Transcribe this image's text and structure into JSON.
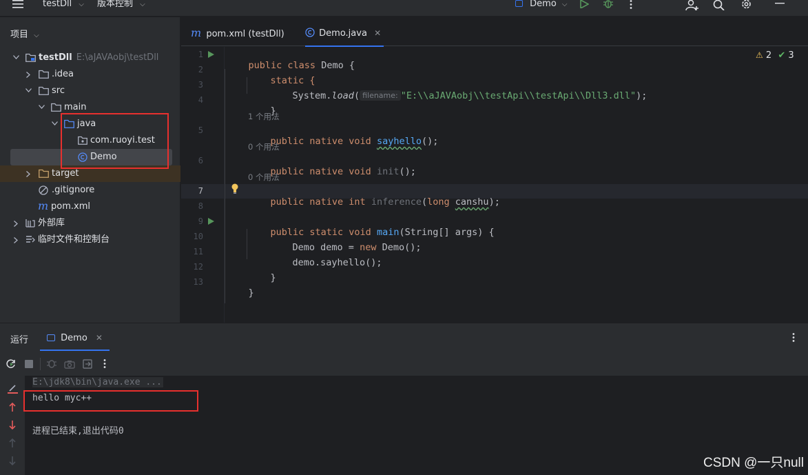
{
  "topbar": {
    "project_name": "testDll",
    "vcs_label": "版本控制",
    "run_config": "Demo"
  },
  "project_panel": {
    "title": "项目",
    "tree": [
      {
        "label": "testDll",
        "path": "E:\\aJAVAobj\\testDll"
      },
      {
        "label": ".idea"
      },
      {
        "label": "src"
      },
      {
        "label": "main"
      },
      {
        "label": "java"
      },
      {
        "label": "com.ruoyi.test"
      },
      {
        "label": "Demo"
      },
      {
        "label": "target"
      },
      {
        "label": ".gitignore"
      },
      {
        "label": "pom.xml"
      },
      {
        "label": "外部库"
      },
      {
        "label": "临时文件和控制台"
      }
    ]
  },
  "tabs": [
    {
      "label": "pom.xml (testDll)"
    },
    {
      "label": "Demo.java"
    }
  ],
  "editor": {
    "line_numbers": [
      "1",
      "2",
      "3",
      "4",
      "5",
      "6",
      "7",
      "8",
      "9",
      "10",
      "11",
      "12",
      "13"
    ],
    "inspections": {
      "warnings": "2",
      "ok": "3"
    },
    "usages": [
      "1 个用法",
      "0 个用法",
      "0 个用法"
    ],
    "param_hint": "filename:",
    "load_path": "\"E:\\\\aJAVAobj\\\\testApi\\\\testApi\\\\Dll3.dll\"",
    "code": {
      "l1_kw": "public class",
      "l1_name": "Demo {",
      "l2": "static {",
      "l3_a": "System.",
      "l3_b": "load",
      "l3_c": "(",
      "l3_end": ");",
      "l4": "}",
      "l5_kw": "public native void",
      "l5_fn": "sayhello",
      "l5_end": "();",
      "l6_kw": "public native void",
      "l6_fn": "init",
      "l6_end": "();",
      "l7_kw": "public native int",
      "l7_fn": "inference",
      "l7_p1": "(",
      "l7_type": "long",
      "l7_arg": "canshu",
      "l7_end": ");",
      "l9_kw": "public static void",
      "l9_fn": "main",
      "l9_end": "(String[] args) {",
      "l10_a": "Demo demo = ",
      "l10_kw": "new",
      "l10_b": " Demo();",
      "l11": "demo.sayhello();",
      "l12": "}",
      "l13": "}"
    }
  },
  "run_panel": {
    "title": "运行",
    "tab_label": "Demo",
    "console": [
      "E:\\jdk8\\bin\\java.exe ...",
      "hello myc++",
      "进程已结束,退出代码0"
    ]
  },
  "watermark": "CSDN @一只null",
  "colors": {
    "background": "#1e1f22",
    "panel": "#2b2d30",
    "keyword": "#cf8e6d",
    "string": "#6aab73",
    "function": "#56a8f5",
    "accent": "#3574f0",
    "annotation_box": "#e8302e"
  }
}
